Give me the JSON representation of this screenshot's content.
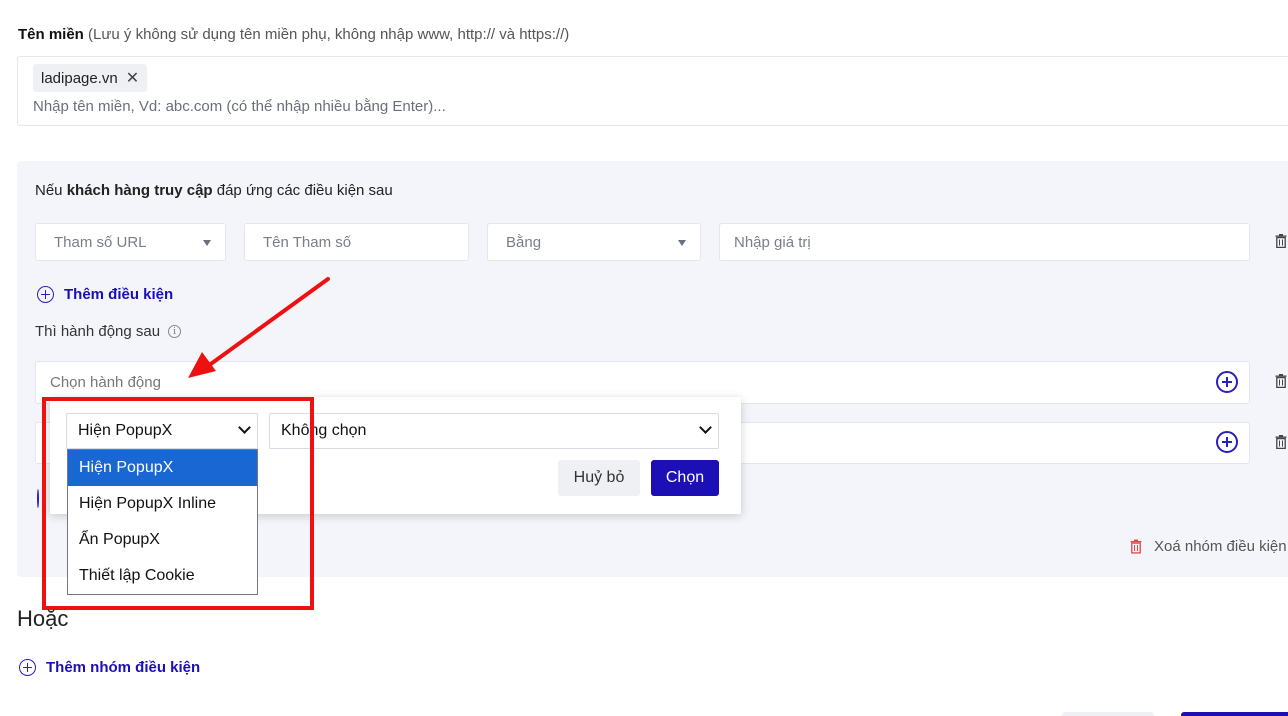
{
  "domain": {
    "label_bold": "Tên miền",
    "label_note": "(Lưu ý không sử dụng tên miền phụ, không nhập www, http:// và https://)",
    "tag": "ladipage.vn",
    "tag_remove": "✕",
    "placeholder": "Nhập tên miền, Vd: abc.com (có thể nhập nhiều bằng Enter)..."
  },
  "conditions": {
    "title_prefix": "Nếu",
    "title_bold": "khách hàng truy cập",
    "title_suffix": "đáp ứng các điều kiện sau",
    "param_type": "Tham số URL",
    "param_name_placeholder": "Tên Tham số",
    "operator": "Bằng",
    "value_placeholder": "Nhập giá trị",
    "add_condition": "Thêm điều kiện"
  },
  "actions": {
    "label": "Thì hành động sau",
    "info": "i",
    "placeholder": "Chọn hành động"
  },
  "popup": {
    "action_select": "Hiện PopupX",
    "target_select": "Không chọn",
    "cancel": "Huỷ bỏ",
    "confirm": "Chọn",
    "options": [
      "Hiện PopupX",
      "Hiện PopupX Inline",
      "Ẩn PopupX",
      "Thiết lập Cookie"
    ]
  },
  "group": {
    "delete": "Xoá nhóm điều kiện"
  },
  "or_label": "Hoặc",
  "add_group": "Thêm nhóm điều kiện",
  "colors": {
    "accent": "#1c0fb5",
    "highlight": "#ee1111",
    "selected_option": "#1967d2"
  }
}
